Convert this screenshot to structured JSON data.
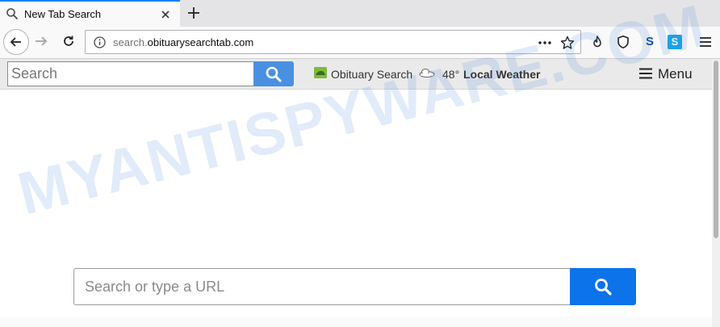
{
  "browser": {
    "tab": {
      "title": "New Tab Search"
    },
    "url": {
      "prefix": "search.",
      "domain": "obituarysearchtab.com"
    }
  },
  "site": {
    "top_search": {
      "placeholder": "Search"
    },
    "obituary_link": "Obituary Search",
    "weather": {
      "temp": "48°",
      "label": "Local Weather"
    },
    "menu_label": "Menu"
  },
  "main_search": {
    "placeholder": "Search or type a URL"
  },
  "watermark": "MYANTISPYWARE.COM",
  "colors": {
    "accent": "#0a84ff",
    "search_button": "#4a90e2",
    "main_search_button": "#0d73ea"
  },
  "icons": {
    "tab": "search-icon",
    "close": "close-icon",
    "new_tab": "plus-icon",
    "back": "arrow-left-icon",
    "forward": "arrow-right-icon",
    "reload": "reload-icon",
    "info": "info-icon",
    "page_actions": "ellipsis-icon",
    "bookmark": "star-icon",
    "extensions": [
      "fire-icon",
      "shield-icon",
      "s-extension-icon",
      "s-square-extension-icon"
    ],
    "browser_menu": "hamburger-icon"
  }
}
